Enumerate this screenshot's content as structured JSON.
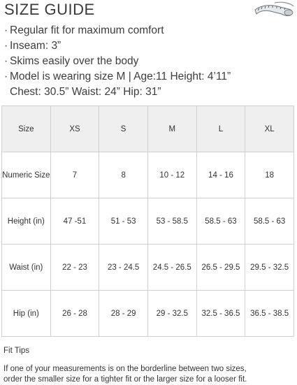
{
  "title": "SIZE GUIDE",
  "bullets": [
    "Regular fit for maximum comfort",
    "Inseam: 3”",
    "Skims easily over the body",
    "Model is wearing size M  |  Age:11   Height: 4’11”"
  ],
  "measurements": "Chest: 30.5”   Waist: 24”   Hip: 31”",
  "bullet_symbol": "·",
  "icons": {
    "tape": "measuring-tape-icon"
  },
  "table": {
    "header": [
      "Size",
      "XS",
      "S",
      "M",
      "L",
      "XL"
    ],
    "rows": [
      [
        "Numeric Size",
        "7",
        "8",
        "10 - 12",
        "14 - 16",
        "18"
      ],
      [
        "Height (in)",
        "47 -51",
        "51 - 53",
        "53 - 58.5",
        "58.5 - 63",
        "58.5 - 63"
      ],
      [
        "Waist (in)",
        "22 - 23",
        "23 - 24.5",
        "24.5 - 26.5",
        "26.5 - 29.5",
        "29.5 - 32.5"
      ],
      [
        "Hip (in)",
        "26 - 28",
        "28 - 29",
        "29 - 32.5",
        "32.5 - 36.5",
        "36.5 - 38.5"
      ]
    ]
  },
  "fit_tips": {
    "title": "Fit Tips",
    "lines": [
      "If one of your measurements is on the borderline between two sizes,",
      "order the smaller size for a tighter fit or the larger size for a looser fit."
    ]
  },
  "colors": {
    "header_bg": "#efefef",
    "border": "#cfcfcf",
    "text": "#3c3c3c"
  }
}
